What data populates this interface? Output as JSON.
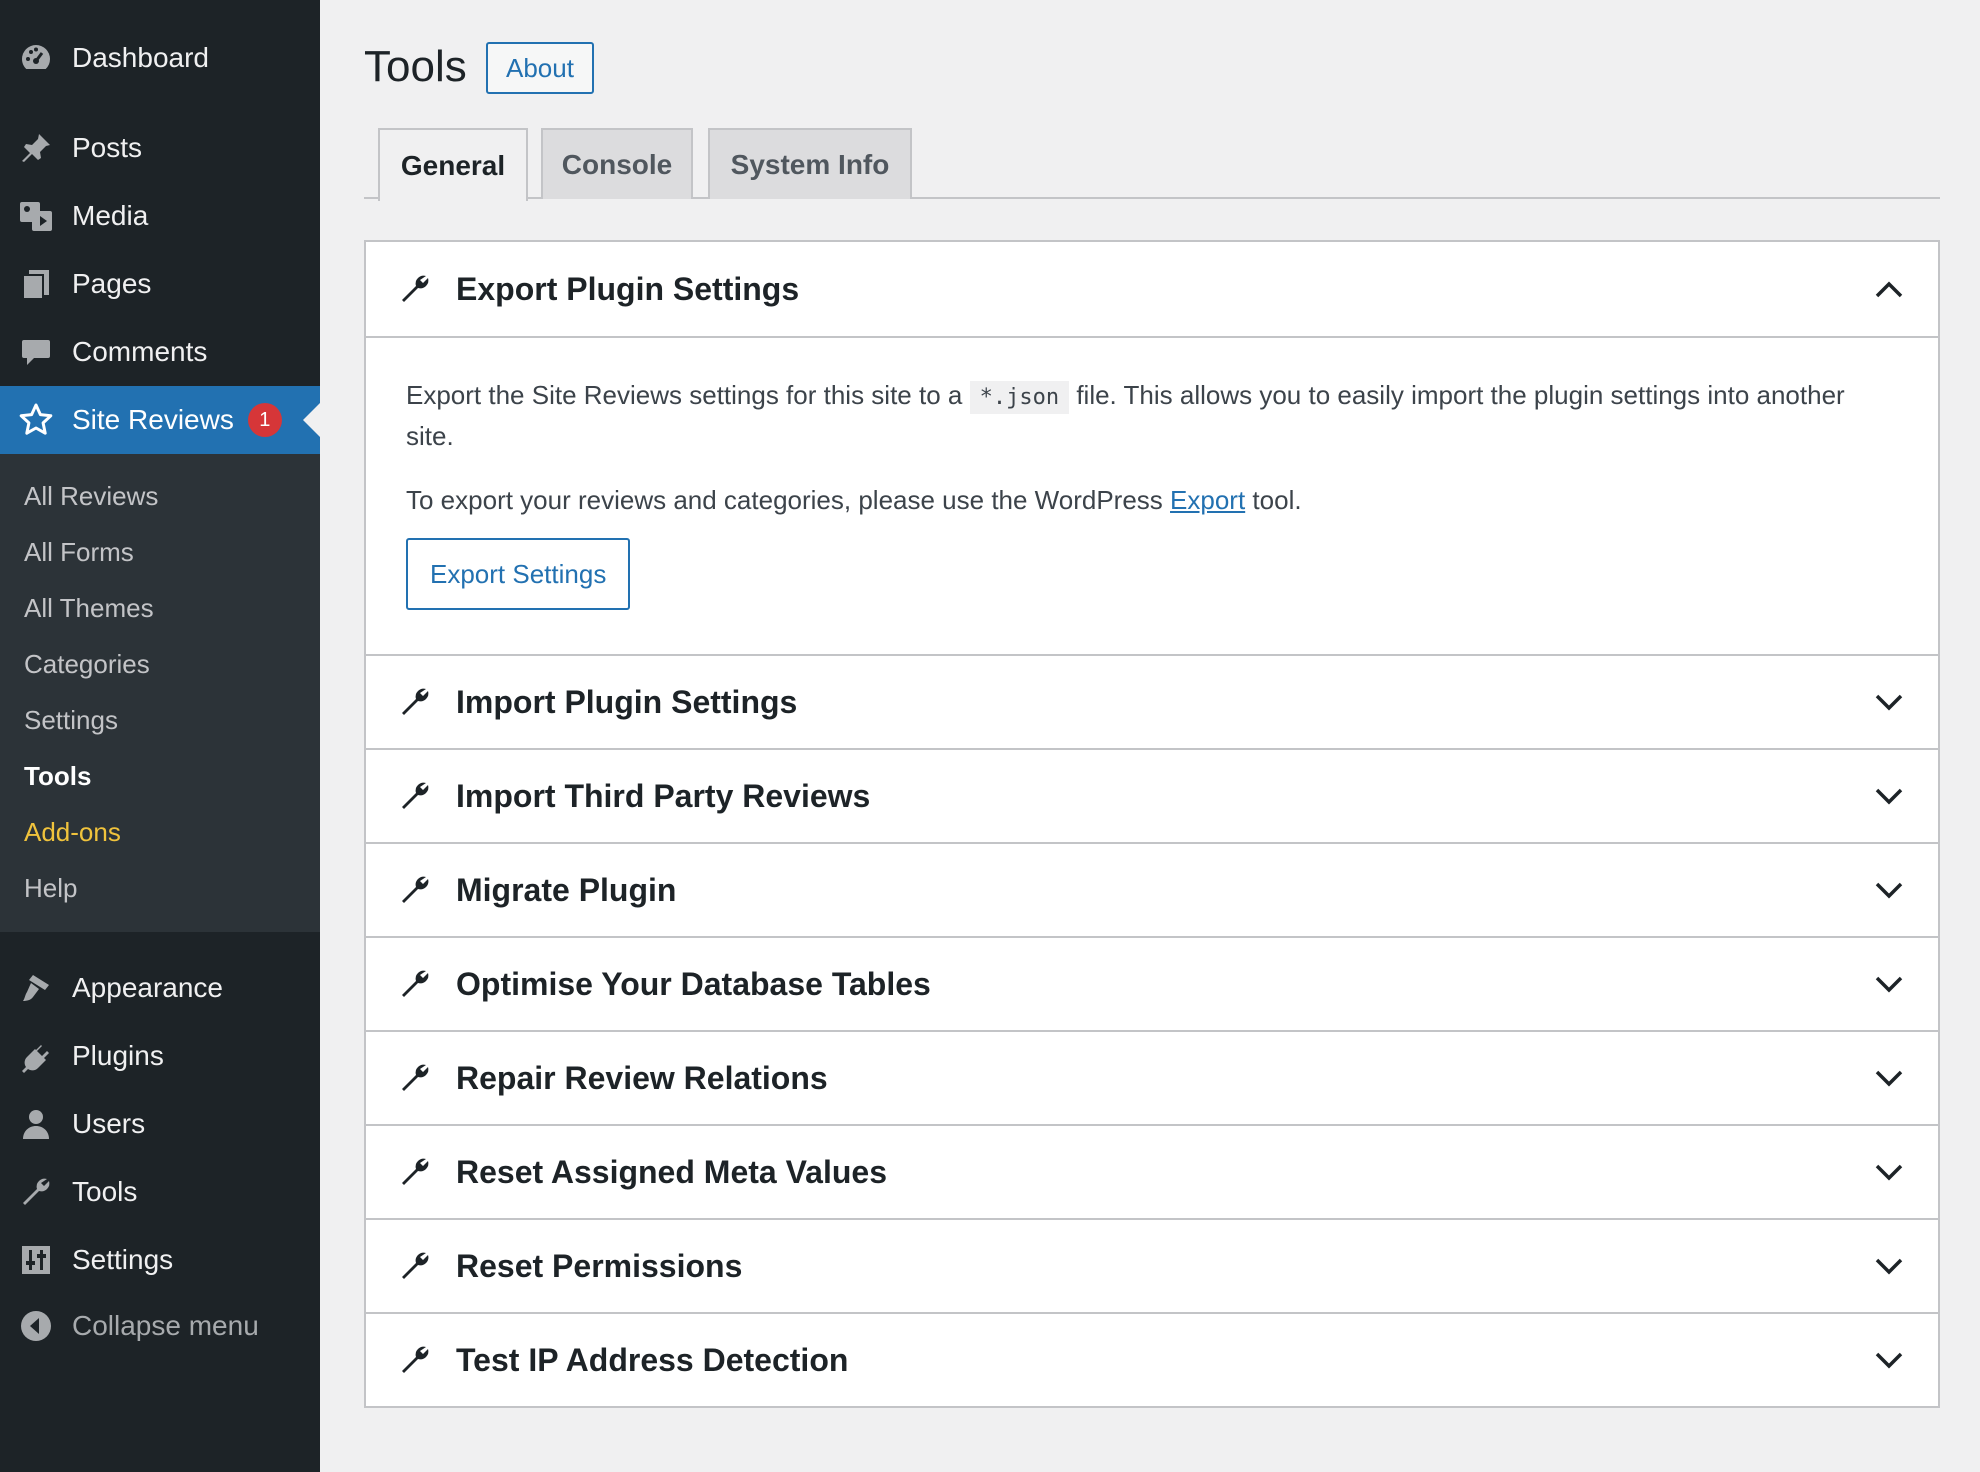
{
  "sidebar": {
    "items_top": [
      {
        "label": "Dashboard",
        "icon": "dashboard-icon"
      },
      {
        "label": "Posts",
        "icon": "pin-icon"
      },
      {
        "label": "Media",
        "icon": "media-icon"
      },
      {
        "label": "Pages",
        "icon": "pages-icon"
      },
      {
        "label": "Comments",
        "icon": "comment-icon"
      }
    ],
    "active": {
      "label": "Site Reviews",
      "icon": "star-icon",
      "badge": "1"
    },
    "submenu": [
      "All Reviews",
      "All Forms",
      "All Themes",
      "Categories",
      "Settings",
      "Tools",
      "Add-ons",
      "Help"
    ],
    "submenu_current": "Tools",
    "items_bottom": [
      {
        "label": "Appearance",
        "icon": "brush-icon"
      },
      {
        "label": "Plugins",
        "icon": "plugin-icon"
      },
      {
        "label": "Users",
        "icon": "user-icon"
      },
      {
        "label": "Tools",
        "icon": "wrench-icon"
      },
      {
        "label": "Settings",
        "icon": "sliders-icon"
      }
    ],
    "collapse": {
      "label": "Collapse menu",
      "icon": "collapse-arrow-icon"
    }
  },
  "header": {
    "title": "Tools",
    "about": "About"
  },
  "tabs": [
    {
      "label": "General",
      "active": true
    },
    {
      "label": "Console",
      "active": false
    },
    {
      "label": "System Info",
      "active": false
    }
  ],
  "export_panel": {
    "title": "Export Plugin Settings",
    "text1_a": "Export the Site Reviews settings for this site to a",
    "code": "*.json",
    "text1_b": "file. This allows you to easily import the plugin settings into another site.",
    "text2_a": "To export your reviews and categories, please use the WordPress",
    "text2_link": "Export",
    "text2_b": "tool.",
    "button": "Export Settings"
  },
  "panels": [
    "Import Plugin Settings",
    "Import Third Party Reviews",
    "Migrate Plugin",
    "Optimise Your Database Tables",
    "Repair Review Relations",
    "Reset Assigned Meta Values",
    "Reset Permissions",
    "Test IP Address Detection"
  ],
  "colors": {
    "accent": "#2271b1",
    "sidebar": "#1d2327",
    "submenu": "#2c3338",
    "badge": "#d63638",
    "addons": "#f0c33c"
  }
}
